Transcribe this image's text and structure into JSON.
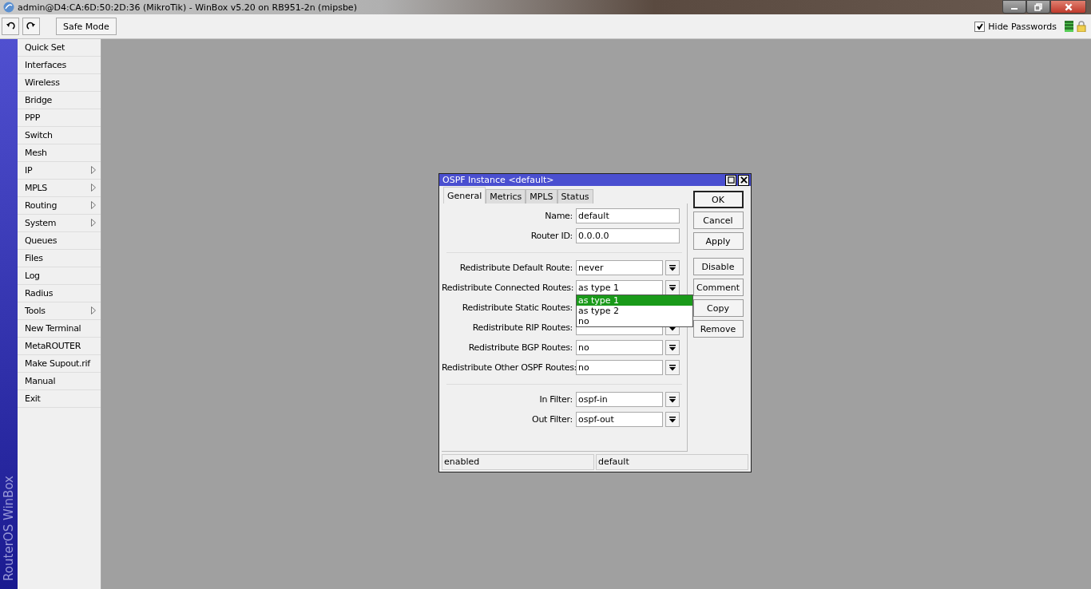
{
  "window": {
    "title": "admin@D4:CA:6D:50:2D:36 (MikroTik) - WinBox v5.20 on RB951-2n (mipsbe)"
  },
  "toolbar": {
    "safe_mode": "Safe Mode",
    "hide_passwords": {
      "label": "Hide Passwords",
      "checked": true
    }
  },
  "sidebar": {
    "brand": "RouterOS WinBox",
    "items": [
      {
        "label": "Quick Set",
        "submenu": false
      },
      {
        "label": "Interfaces",
        "submenu": false
      },
      {
        "label": "Wireless",
        "submenu": false
      },
      {
        "label": "Bridge",
        "submenu": false
      },
      {
        "label": "PPP",
        "submenu": false
      },
      {
        "label": "Switch",
        "submenu": false
      },
      {
        "label": "Mesh",
        "submenu": false
      },
      {
        "label": "IP",
        "submenu": true
      },
      {
        "label": "MPLS",
        "submenu": true
      },
      {
        "label": "Routing",
        "submenu": true
      },
      {
        "label": "System",
        "submenu": true
      },
      {
        "label": "Queues",
        "submenu": false
      },
      {
        "label": "Files",
        "submenu": false
      },
      {
        "label": "Log",
        "submenu": false
      },
      {
        "label": "Radius",
        "submenu": false
      },
      {
        "label": "Tools",
        "submenu": true
      },
      {
        "label": "New Terminal",
        "submenu": false
      },
      {
        "label": "MetaROUTER",
        "submenu": false
      },
      {
        "label": "Make Supout.rif",
        "submenu": false
      },
      {
        "label": "Manual",
        "submenu": false
      },
      {
        "label": "Exit",
        "submenu": false
      }
    ]
  },
  "dialog": {
    "title": "OSPF Instance <default>",
    "tabs": [
      {
        "label": "General",
        "selected": true
      },
      {
        "label": "Metrics",
        "selected": false
      },
      {
        "label": "MPLS",
        "selected": false
      },
      {
        "label": "Status",
        "selected": false
      }
    ],
    "fields": [
      {
        "kind": "text",
        "label": "Name:",
        "value": "default"
      },
      {
        "kind": "text",
        "label": "Router ID:",
        "value": "0.0.0.0"
      },
      {
        "kind": "separator"
      },
      {
        "kind": "select",
        "label": "Redistribute Default Route:",
        "value": "never"
      },
      {
        "kind": "select",
        "label": "Redistribute Connected Routes:",
        "value": "as type 1",
        "options": [
          {
            "label": "as type 1",
            "selected": true
          },
          {
            "label": "as type 2",
            "selected": false
          },
          {
            "label": "no",
            "selected": false
          }
        ]
      },
      {
        "kind": "select",
        "label": "Redistribute Static Routes:"
      },
      {
        "kind": "select",
        "label": "Redistribute RIP Routes:"
      },
      {
        "kind": "select",
        "label": "Redistribute BGP Routes:",
        "value": "no"
      },
      {
        "kind": "select",
        "label": "Redistribute Other OSPF Routes:",
        "value": "no"
      },
      {
        "kind": "separator"
      },
      {
        "kind": "select",
        "label": "In Filter:",
        "value": "ospf-in"
      },
      {
        "kind": "select",
        "label": "Out Filter:",
        "value": "ospf-out"
      }
    ],
    "buttons": [
      {
        "label": "OK",
        "default": true
      },
      {
        "label": "Cancel",
        "default": false
      },
      {
        "label": "Apply",
        "default": false
      },
      {
        "label": "Disable",
        "default": false
      },
      {
        "label": "Comment",
        "default": false
      },
      {
        "label": "Copy",
        "default": false
      },
      {
        "label": "Remove",
        "default": false
      }
    ],
    "status": [
      "enabled",
      "default"
    ]
  }
}
